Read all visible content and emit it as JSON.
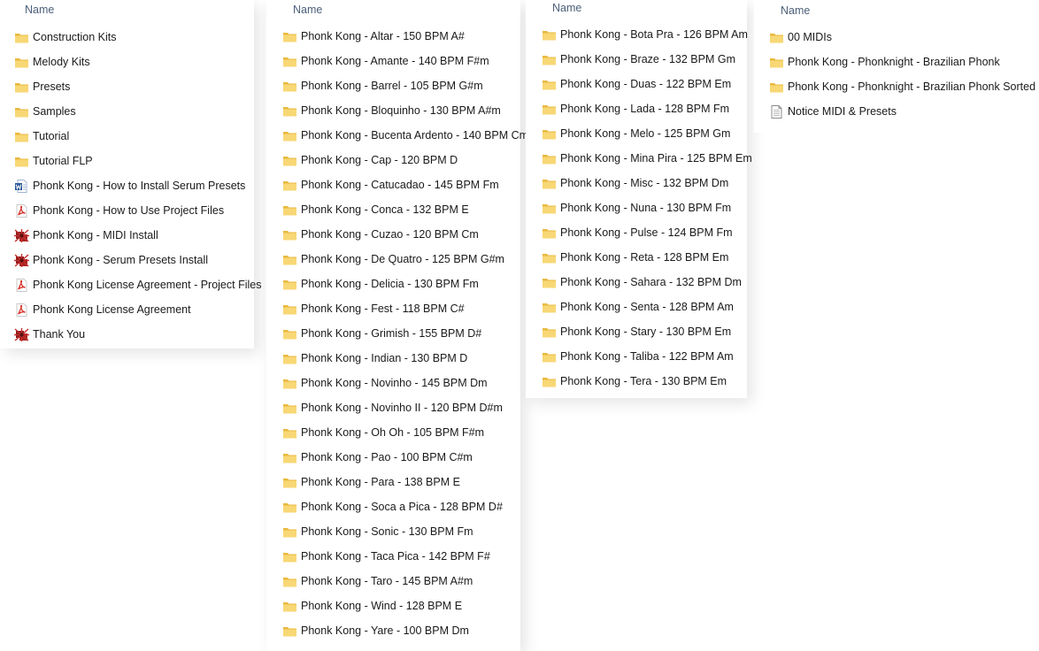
{
  "columns": [
    {
      "header": "Name",
      "items": [
        {
          "name": "Construction Kits",
          "icon": "folder-icon"
        },
        {
          "name": "Melody Kits",
          "icon": "folder-icon"
        },
        {
          "name": "Presets",
          "icon": "folder-icon"
        },
        {
          "name": "Samples",
          "icon": "folder-icon"
        },
        {
          "name": "Tutorial",
          "icon": "folder-icon"
        },
        {
          "name": "Tutorial FLP",
          "icon": "folder-icon"
        },
        {
          "name": "Phonk Kong - How to Install Serum Presets",
          "icon": "word-document-icon"
        },
        {
          "name": "Phonk Kong - How to Use Project Files",
          "icon": "pdf-file-icon"
        },
        {
          "name": "Phonk Kong - MIDI Install",
          "icon": "installer-icon"
        },
        {
          "name": "Phonk Kong - Serum Presets Install",
          "icon": "installer-icon"
        },
        {
          "name": "Phonk Kong License Agreement - Project Files",
          "icon": "pdf-file-icon"
        },
        {
          "name": "Phonk Kong License Agreement",
          "icon": "pdf-file-icon"
        },
        {
          "name": "Thank You",
          "icon": "installer-icon"
        }
      ]
    },
    {
      "header": "Name",
      "items": [
        {
          "name": "Phonk Kong - Altar - 150 BPM A#",
          "icon": "folder-icon"
        },
        {
          "name": "Phonk Kong - Amante - 140 BPM F#m",
          "icon": "folder-icon"
        },
        {
          "name": "Phonk Kong - Barrel - 105 BPM G#m",
          "icon": "folder-icon"
        },
        {
          "name": "Phonk Kong - Bloquinho - 130 BPM A#m",
          "icon": "folder-icon"
        },
        {
          "name": "Phonk Kong - Bucenta Ardento - 140 BPM Cm",
          "icon": "folder-icon"
        },
        {
          "name": "Phonk Kong - Cap - 120 BPM D",
          "icon": "folder-icon"
        },
        {
          "name": "Phonk Kong - Catucadao - 145 BPM Fm",
          "icon": "folder-icon"
        },
        {
          "name": "Phonk Kong - Conca - 132 BPM E",
          "icon": "folder-icon"
        },
        {
          "name": "Phonk Kong - Cuzao - 120 BPM Cm",
          "icon": "folder-icon"
        },
        {
          "name": "Phonk Kong - De Quatro - 125 BPM G#m",
          "icon": "folder-icon"
        },
        {
          "name": "Phonk Kong - Delicia - 130 BPM Fm",
          "icon": "folder-icon"
        },
        {
          "name": "Phonk Kong - Fest - 118 BPM C#",
          "icon": "folder-icon"
        },
        {
          "name": "Phonk Kong - Grimish  - 155 BPM D#",
          "icon": "folder-icon"
        },
        {
          "name": "Phonk Kong - Indian - 130 BPM D",
          "icon": "folder-icon"
        },
        {
          "name": "Phonk Kong - Novinho - 145 BPM Dm",
          "icon": "folder-icon"
        },
        {
          "name": "Phonk Kong - Novinho II - 120 BPM D#m",
          "icon": "folder-icon"
        },
        {
          "name": "Phonk Kong - Oh Oh - 105 BPM F#m",
          "icon": "folder-icon"
        },
        {
          "name": "Phonk Kong - Pao - 100 BPM C#m",
          "icon": "folder-icon"
        },
        {
          "name": "Phonk Kong - Para - 138 BPM E",
          "icon": "folder-icon"
        },
        {
          "name": "Phonk Kong - Soca a Pica - 128 BPM D#",
          "icon": "folder-icon"
        },
        {
          "name": "Phonk Kong - Sonic - 130 BPM Fm",
          "icon": "folder-icon"
        },
        {
          "name": "Phonk Kong - Taca Pica - 142 BPM F#",
          "icon": "folder-icon"
        },
        {
          "name": "Phonk Kong - Taro - 145 BPM A#m",
          "icon": "folder-icon"
        },
        {
          "name": "Phonk Kong - Wind - 128 BPM E",
          "icon": "folder-icon"
        },
        {
          "name": "Phonk Kong - Yare - 100 BPM Dm",
          "icon": "folder-icon"
        }
      ]
    },
    {
      "header": "Name",
      "items": [
        {
          "name": "Phonk Kong - Bota Pra - 126 BPM Am",
          "icon": "folder-icon"
        },
        {
          "name": "Phonk Kong - Braze - 132 BPM Gm",
          "icon": "folder-icon"
        },
        {
          "name": "Phonk Kong - Duas - 122 BPM Em",
          "icon": "folder-icon"
        },
        {
          "name": "Phonk Kong - Lada - 128 BPM Fm",
          "icon": "folder-icon"
        },
        {
          "name": "Phonk Kong - Melo - 125 BPM Gm",
          "icon": "folder-icon"
        },
        {
          "name": "Phonk Kong - Mina Pira - 125 BPM Em",
          "icon": "folder-icon"
        },
        {
          "name": "Phonk Kong - Misc - 132 BPM Dm",
          "icon": "folder-icon"
        },
        {
          "name": "Phonk Kong - Nuna - 130 BPM Fm",
          "icon": "folder-icon"
        },
        {
          "name": "Phonk Kong - Pulse - 124 BPM Fm",
          "icon": "folder-icon"
        },
        {
          "name": "Phonk Kong - Reta - 128 BPM Em",
          "icon": "folder-icon"
        },
        {
          "name": "Phonk Kong - Sahara - 132 BPM Dm",
          "icon": "folder-icon"
        },
        {
          "name": "Phonk Kong - Senta - 128 BPM Am",
          "icon": "folder-icon"
        },
        {
          "name": "Phonk Kong - Stary - 130 BPM Em",
          "icon": "folder-icon"
        },
        {
          "name": "Phonk Kong - Taliba - 122 BPM Am",
          "icon": "folder-icon"
        },
        {
          "name": "Phonk Kong - Tera - 130 BPM Em",
          "icon": "folder-icon"
        }
      ]
    },
    {
      "header": "Name",
      "items": [
        {
          "name": "00 MIDIs",
          "icon": "folder-icon"
        },
        {
          "name": "Phonk Kong - Phonknight - Brazilian Phonk",
          "icon": "folder-icon"
        },
        {
          "name": "Phonk Kong - Phonknight - Brazilian Phonk Sorted",
          "icon": "folder-icon"
        },
        {
          "name": "Notice MIDI & Presets",
          "icon": "text-document-icon"
        }
      ]
    }
  ],
  "colors": {
    "header_text": "#4c607a",
    "item_text": "#1a1a1a",
    "folder_body": "#f8d775",
    "folder_tab": "#e9b93f",
    "pdf_red": "#d6302a",
    "word_blue": "#2b5797"
  }
}
